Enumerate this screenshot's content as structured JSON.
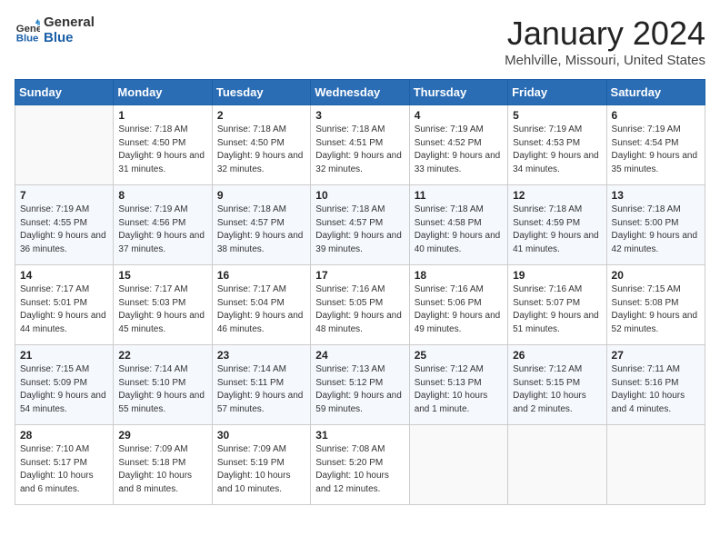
{
  "header": {
    "logo_line1": "General",
    "logo_line2": "Blue",
    "title": "January 2024",
    "subtitle": "Mehlville, Missouri, United States"
  },
  "weekdays": [
    "Sunday",
    "Monday",
    "Tuesday",
    "Wednesday",
    "Thursday",
    "Friday",
    "Saturday"
  ],
  "weeks": [
    [
      {
        "day": "",
        "sunrise": "",
        "sunset": "",
        "daylight": ""
      },
      {
        "day": "1",
        "sunrise": "7:18 AM",
        "sunset": "4:50 PM",
        "daylight": "9 hours and 31 minutes."
      },
      {
        "day": "2",
        "sunrise": "7:18 AM",
        "sunset": "4:50 PM",
        "daylight": "9 hours and 32 minutes."
      },
      {
        "day": "3",
        "sunrise": "7:18 AM",
        "sunset": "4:51 PM",
        "daylight": "9 hours and 32 minutes."
      },
      {
        "day": "4",
        "sunrise": "7:19 AM",
        "sunset": "4:52 PM",
        "daylight": "9 hours and 33 minutes."
      },
      {
        "day": "5",
        "sunrise": "7:19 AM",
        "sunset": "4:53 PM",
        "daylight": "9 hours and 34 minutes."
      },
      {
        "day": "6",
        "sunrise": "7:19 AM",
        "sunset": "4:54 PM",
        "daylight": "9 hours and 35 minutes."
      }
    ],
    [
      {
        "day": "7",
        "sunrise": "7:19 AM",
        "sunset": "4:55 PM",
        "daylight": "9 hours and 36 minutes."
      },
      {
        "day": "8",
        "sunrise": "7:19 AM",
        "sunset": "4:56 PM",
        "daylight": "9 hours and 37 minutes."
      },
      {
        "day": "9",
        "sunrise": "7:18 AM",
        "sunset": "4:57 PM",
        "daylight": "9 hours and 38 minutes."
      },
      {
        "day": "10",
        "sunrise": "7:18 AM",
        "sunset": "4:57 PM",
        "daylight": "9 hours and 39 minutes."
      },
      {
        "day": "11",
        "sunrise": "7:18 AM",
        "sunset": "4:58 PM",
        "daylight": "9 hours and 40 minutes."
      },
      {
        "day": "12",
        "sunrise": "7:18 AM",
        "sunset": "4:59 PM",
        "daylight": "9 hours and 41 minutes."
      },
      {
        "day": "13",
        "sunrise": "7:18 AM",
        "sunset": "5:00 PM",
        "daylight": "9 hours and 42 minutes."
      }
    ],
    [
      {
        "day": "14",
        "sunrise": "7:17 AM",
        "sunset": "5:01 PM",
        "daylight": "9 hours and 44 minutes."
      },
      {
        "day": "15",
        "sunrise": "7:17 AM",
        "sunset": "5:03 PM",
        "daylight": "9 hours and 45 minutes."
      },
      {
        "day": "16",
        "sunrise": "7:17 AM",
        "sunset": "5:04 PM",
        "daylight": "9 hours and 46 minutes."
      },
      {
        "day": "17",
        "sunrise": "7:16 AM",
        "sunset": "5:05 PM",
        "daylight": "9 hours and 48 minutes."
      },
      {
        "day": "18",
        "sunrise": "7:16 AM",
        "sunset": "5:06 PM",
        "daylight": "9 hours and 49 minutes."
      },
      {
        "day": "19",
        "sunrise": "7:16 AM",
        "sunset": "5:07 PM",
        "daylight": "9 hours and 51 minutes."
      },
      {
        "day": "20",
        "sunrise": "7:15 AM",
        "sunset": "5:08 PM",
        "daylight": "9 hours and 52 minutes."
      }
    ],
    [
      {
        "day": "21",
        "sunrise": "7:15 AM",
        "sunset": "5:09 PM",
        "daylight": "9 hours and 54 minutes."
      },
      {
        "day": "22",
        "sunrise": "7:14 AM",
        "sunset": "5:10 PM",
        "daylight": "9 hours and 55 minutes."
      },
      {
        "day": "23",
        "sunrise": "7:14 AM",
        "sunset": "5:11 PM",
        "daylight": "9 hours and 57 minutes."
      },
      {
        "day": "24",
        "sunrise": "7:13 AM",
        "sunset": "5:12 PM",
        "daylight": "9 hours and 59 minutes."
      },
      {
        "day": "25",
        "sunrise": "7:12 AM",
        "sunset": "5:13 PM",
        "daylight": "10 hours and 1 minute."
      },
      {
        "day": "26",
        "sunrise": "7:12 AM",
        "sunset": "5:15 PM",
        "daylight": "10 hours and 2 minutes."
      },
      {
        "day": "27",
        "sunrise": "7:11 AM",
        "sunset": "5:16 PM",
        "daylight": "10 hours and 4 minutes."
      }
    ],
    [
      {
        "day": "28",
        "sunrise": "7:10 AM",
        "sunset": "5:17 PM",
        "daylight": "10 hours and 6 minutes."
      },
      {
        "day": "29",
        "sunrise": "7:09 AM",
        "sunset": "5:18 PM",
        "daylight": "10 hours and 8 minutes."
      },
      {
        "day": "30",
        "sunrise": "7:09 AM",
        "sunset": "5:19 PM",
        "daylight": "10 hours and 10 minutes."
      },
      {
        "day": "31",
        "sunrise": "7:08 AM",
        "sunset": "5:20 PM",
        "daylight": "10 hours and 12 minutes."
      },
      {
        "day": "",
        "sunrise": "",
        "sunset": "",
        "daylight": ""
      },
      {
        "day": "",
        "sunrise": "",
        "sunset": "",
        "daylight": ""
      },
      {
        "day": "",
        "sunrise": "",
        "sunset": "",
        "daylight": ""
      }
    ]
  ],
  "labels": {
    "sunrise": "Sunrise:",
    "sunset": "Sunset:",
    "daylight": "Daylight:"
  }
}
